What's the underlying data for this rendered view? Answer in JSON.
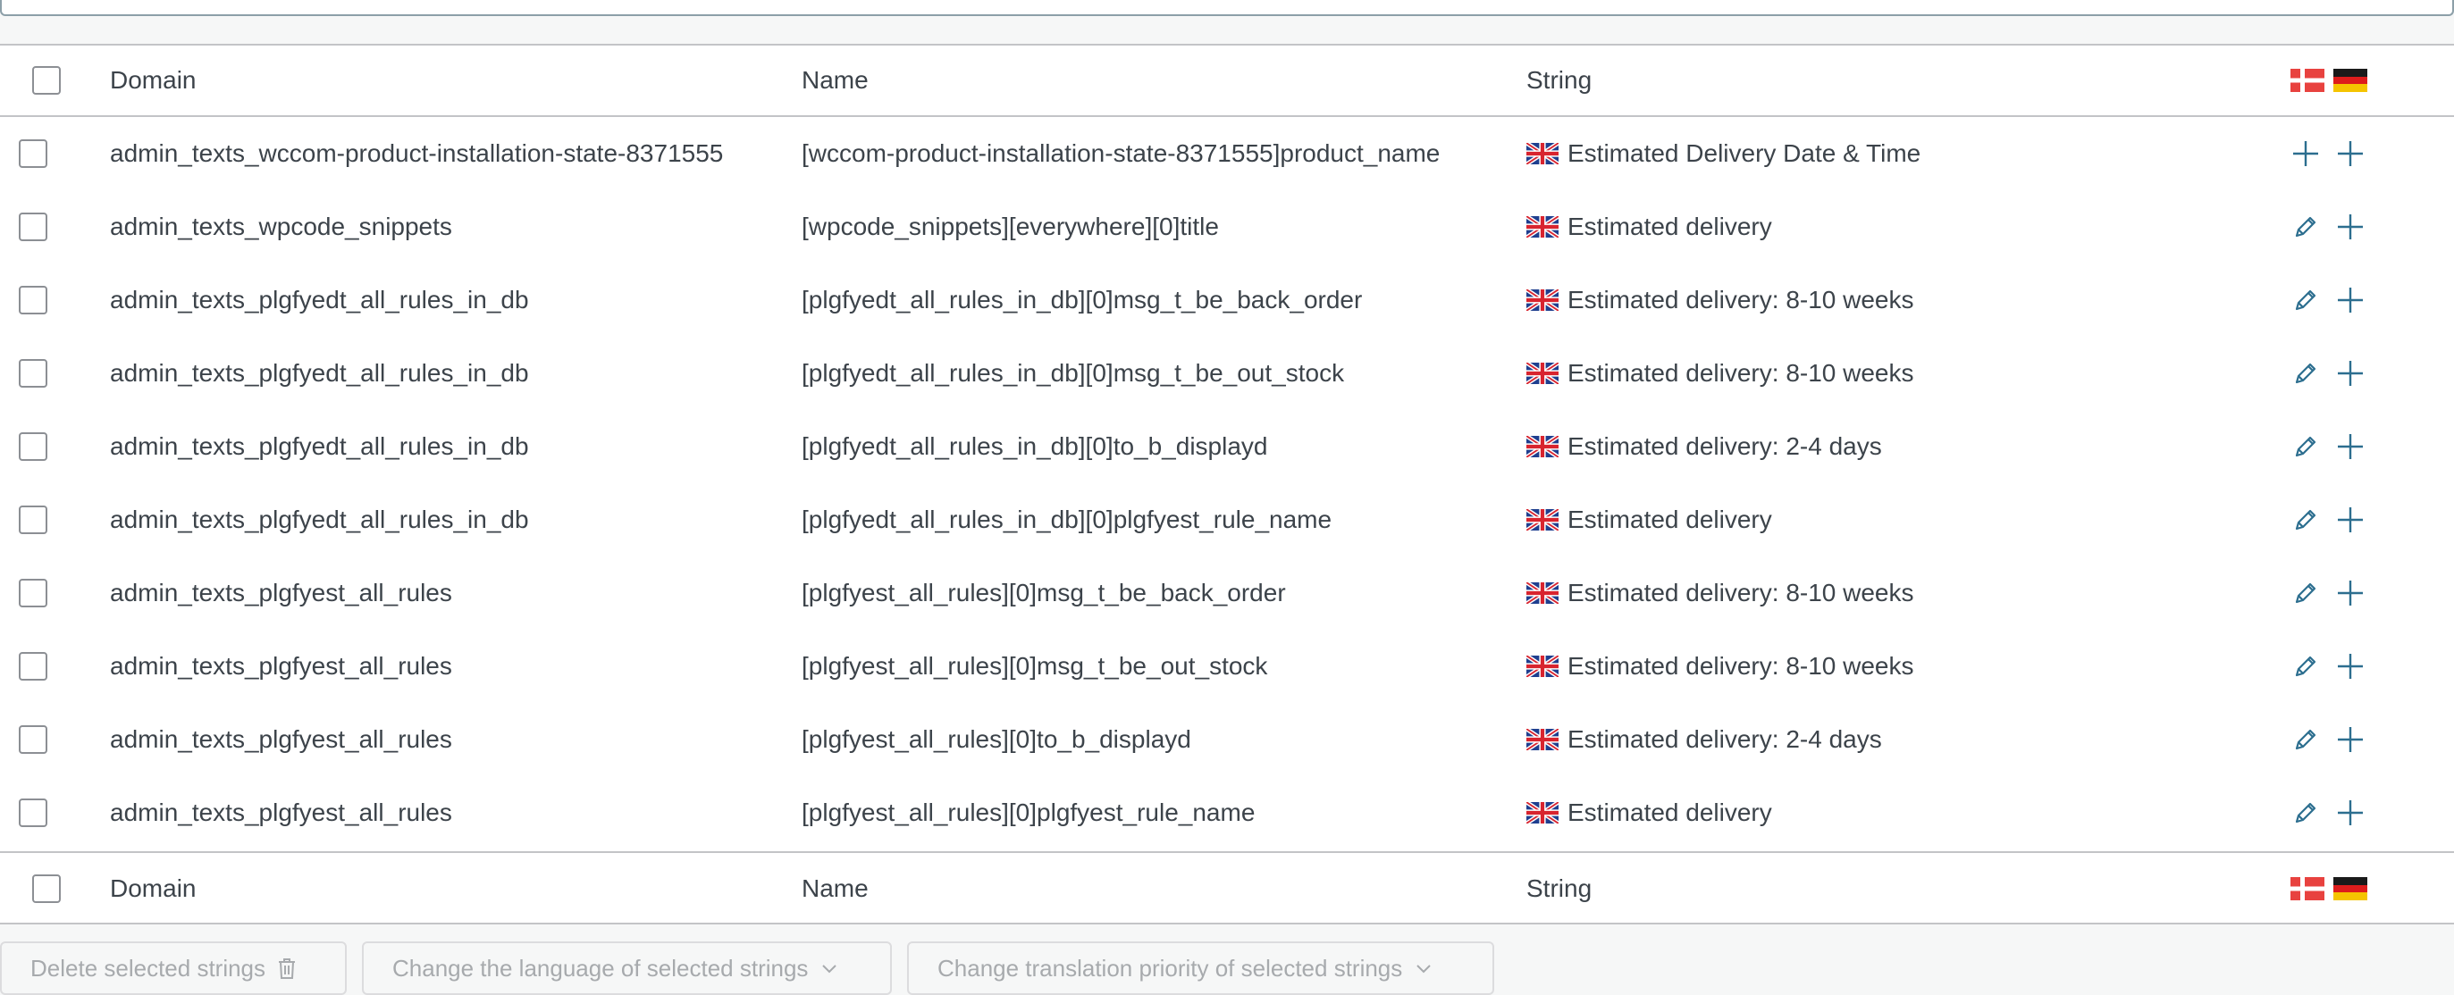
{
  "table": {
    "header": {
      "domain": "Domain",
      "name": "Name",
      "string": "String"
    },
    "footer": {
      "domain": "Domain",
      "name": "Name",
      "string": "String"
    },
    "rows": [
      {
        "domain": "admin_texts_wccom-product-installation-state-8371555",
        "name": "[wccom-product-installation-state-8371555]product_name",
        "string": "Estimated Delivery Date & Time",
        "first_action": "add"
      },
      {
        "domain": "admin_texts_wpcode_snippets",
        "name": "[wpcode_snippets][everywhere][0]title",
        "string": "Estimated delivery",
        "first_action": "edit"
      },
      {
        "domain": "admin_texts_plgfyedt_all_rules_in_db",
        "name": "[plgfyedt_all_rules_in_db][0]msg_t_be_back_order",
        "string": "Estimated delivery: 8-10 weeks",
        "first_action": "edit"
      },
      {
        "domain": "admin_texts_plgfyedt_all_rules_in_db",
        "name": "[plgfyedt_all_rules_in_db][0]msg_t_be_out_stock",
        "string": "Estimated delivery: 8-10 weeks",
        "first_action": "edit"
      },
      {
        "domain": "admin_texts_plgfyedt_all_rules_in_db",
        "name": "[plgfyedt_all_rules_in_db][0]to_b_displayd",
        "string": "Estimated delivery: 2-4 days",
        "first_action": "edit"
      },
      {
        "domain": "admin_texts_plgfyedt_all_rules_in_db",
        "name": "[plgfyedt_all_rules_in_db][0]plgfyest_rule_name",
        "string": "Estimated delivery",
        "first_action": "edit"
      },
      {
        "domain": "admin_texts_plgfyest_all_rules",
        "name": "[plgfyest_all_rules][0]msg_t_be_back_order",
        "string": "Estimated delivery: 8-10 weeks",
        "first_action": "edit"
      },
      {
        "domain": "admin_texts_plgfyest_all_rules",
        "name": "[plgfyest_all_rules][0]msg_t_be_out_stock",
        "string": "Estimated delivery: 8-10 weeks",
        "first_action": "edit"
      },
      {
        "domain": "admin_texts_plgfyest_all_rules",
        "name": "[plgfyest_all_rules][0]to_b_displayd",
        "string": "Estimated delivery: 2-4 days",
        "first_action": "edit"
      },
      {
        "domain": "admin_texts_plgfyest_all_rules",
        "name": "[plgfyest_all_rules][0]plgfyest_rule_name",
        "string": "Estimated delivery",
        "first_action": "edit"
      }
    ]
  },
  "bulk_actions": {
    "delete": "Delete selected strings",
    "change_language": "Change the language of selected strings",
    "change_priority": "Change translation priority of selected strings"
  },
  "icons": {
    "flag_source": "uk-flag-icon",
    "flag_lang_1": "danish-flag-icon",
    "flag_lang_2": "german-flag-icon",
    "edit": "pencil-icon",
    "add": "plus-icon",
    "delete": "trash-icon",
    "dropdown": "chevron-down-icon"
  },
  "colors": {
    "action_icon": "#2c6e8f",
    "text": "#3c434a",
    "border": "#c3c4c7",
    "disabled_text": "#a7aaad"
  }
}
